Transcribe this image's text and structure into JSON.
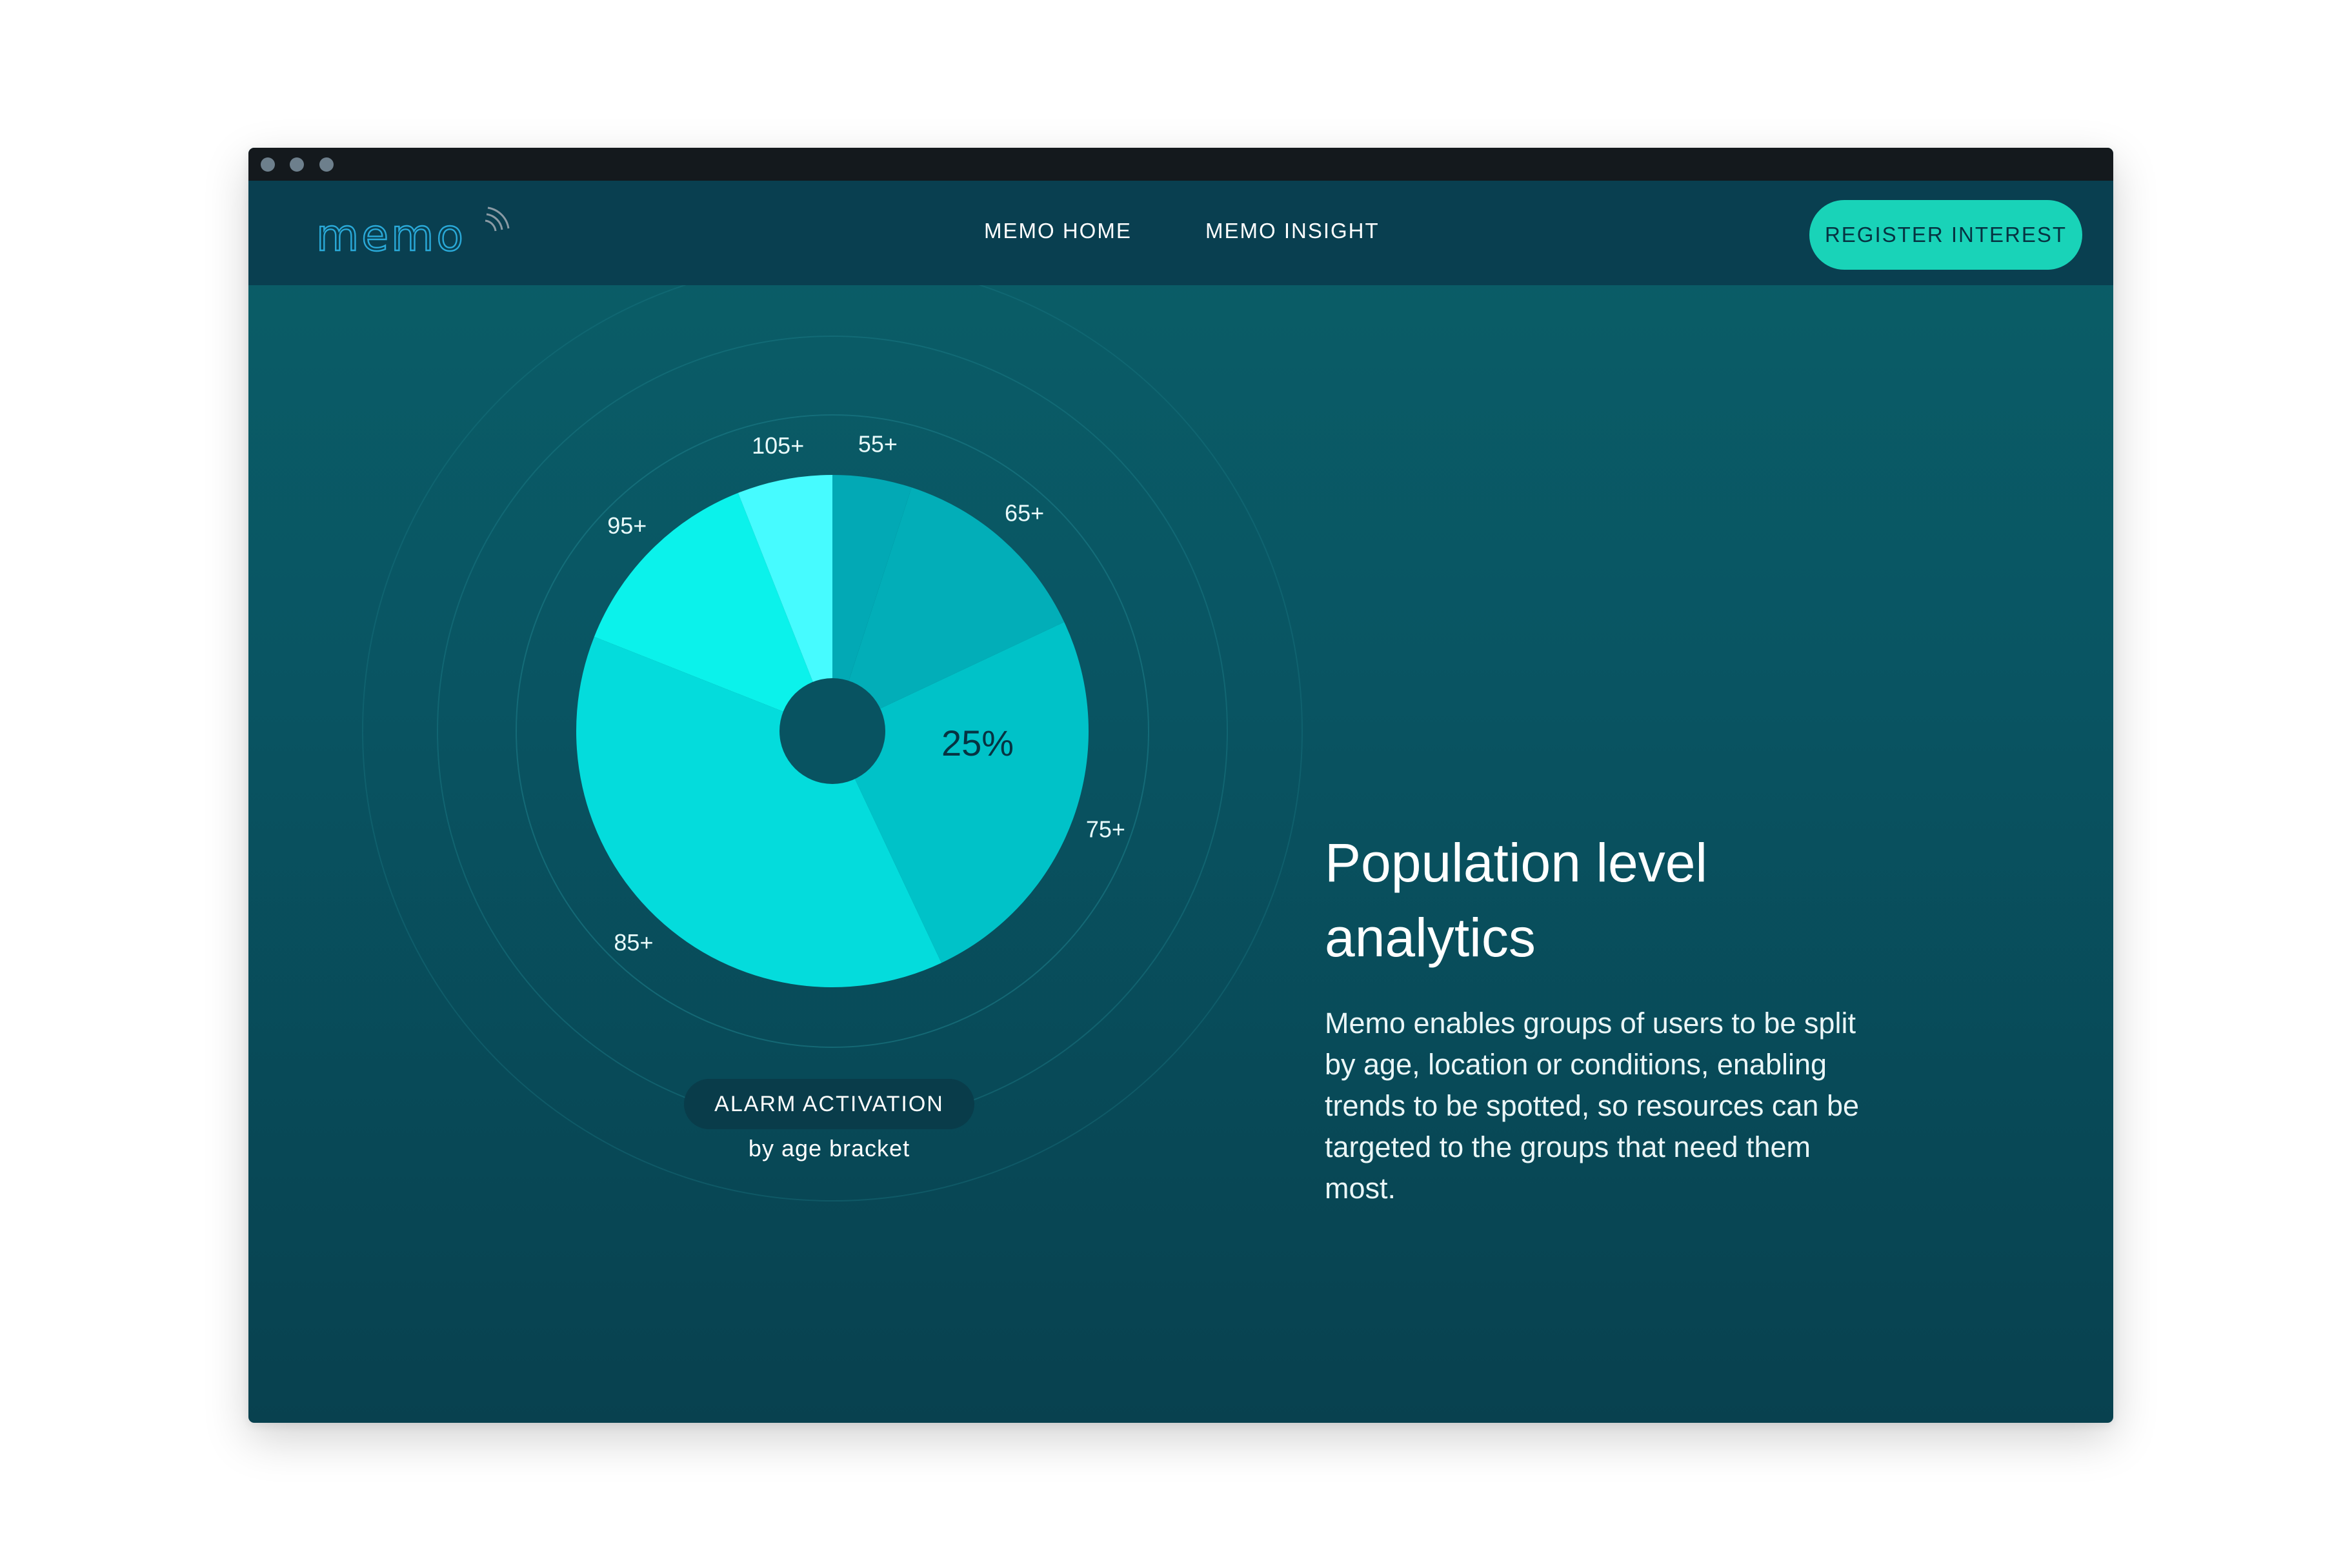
{
  "nav": {
    "logo_text": "memo",
    "links": [
      "MEMO HOME",
      "MEMO INSIGHT"
    ],
    "cta_label": "REGISTER INTEREST"
  },
  "chart_data": {
    "type": "pie",
    "title": "ALARM ACTIVATION",
    "subtitle": "by age bracket",
    "donut": true,
    "highlight_label": "25%",
    "categories": [
      "55+",
      "65+",
      "75+",
      "85+",
      "95+",
      "105+"
    ],
    "values": [
      5,
      13,
      25,
      38,
      13,
      6
    ],
    "colors": [
      "#02a9b5",
      "#02aeb8",
      "#00c2c8",
      "#04dcdc",
      "#0bf2eb",
      "#46fbff"
    ]
  },
  "content": {
    "heading_line1": "Population level",
    "heading_line2": "analytics",
    "body_lines": [
      "Memo enables groups of users to be split",
      "by age, location or conditions, enabling",
      "trends to be spotted, so resources can be",
      "targeted to the groups that need them",
      "most."
    ]
  },
  "colors": {
    "accent": "#19d3b8",
    "navbar": "#093f50",
    "background": "#095563",
    "titlebar": "#14191d"
  }
}
